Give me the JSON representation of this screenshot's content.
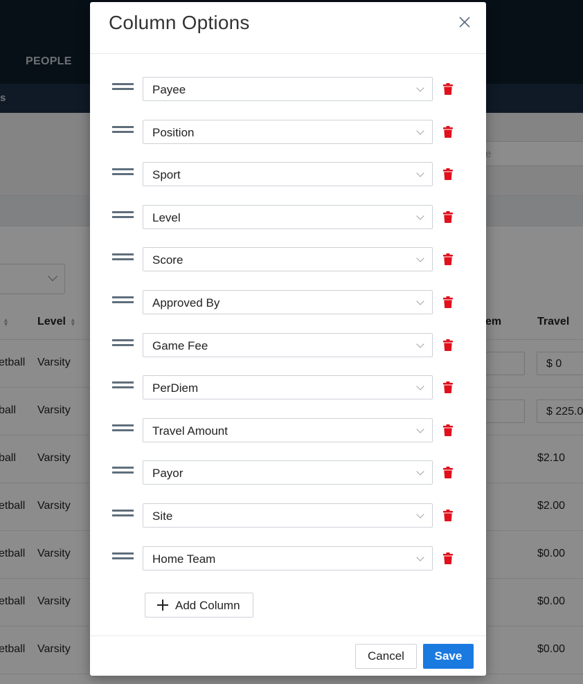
{
  "background": {
    "nav": {
      "people_label": "PEOPLE",
      "sub_label": "s"
    },
    "filter": {
      "search_placeholder_fragment": "e"
    },
    "table": {
      "headers": {
        "level": "Level",
        "perdiem_fragment": "em",
        "travel": "Travel"
      },
      "rows": [
        {
          "sport": "etball",
          "level": "Varsity",
          "travel": "$ 0"
        },
        {
          "sport": "ball",
          "level": "Varsity",
          "travel": "$ 225.0"
        },
        {
          "sport": "ball",
          "level": "Varsity",
          "travel": "$2.10"
        },
        {
          "sport": "etball",
          "level": "Varsity",
          "travel": "$2.00"
        },
        {
          "sport": "etball",
          "level": "Varsity",
          "travel": "$0.00"
        },
        {
          "sport": "etball",
          "level": "Varsity",
          "travel": "$0.00"
        },
        {
          "sport": "etball",
          "level": "Varsity",
          "travel": "$0.00"
        }
      ]
    }
  },
  "modal": {
    "title": "Column Options",
    "columns": [
      "Payee",
      "Position",
      "Sport",
      "Level",
      "Score",
      "Approved By",
      "Game Fee",
      "PerDiem",
      "Travel Amount",
      "Payor",
      "Site",
      "Home Team"
    ],
    "add_column_label": "Add Column",
    "cancel_label": "Cancel",
    "save_label": "Save"
  },
  "colors": {
    "primary": "#1a7ae0",
    "delete": "#e0101c",
    "nav_dark": "#0e1c2b"
  }
}
